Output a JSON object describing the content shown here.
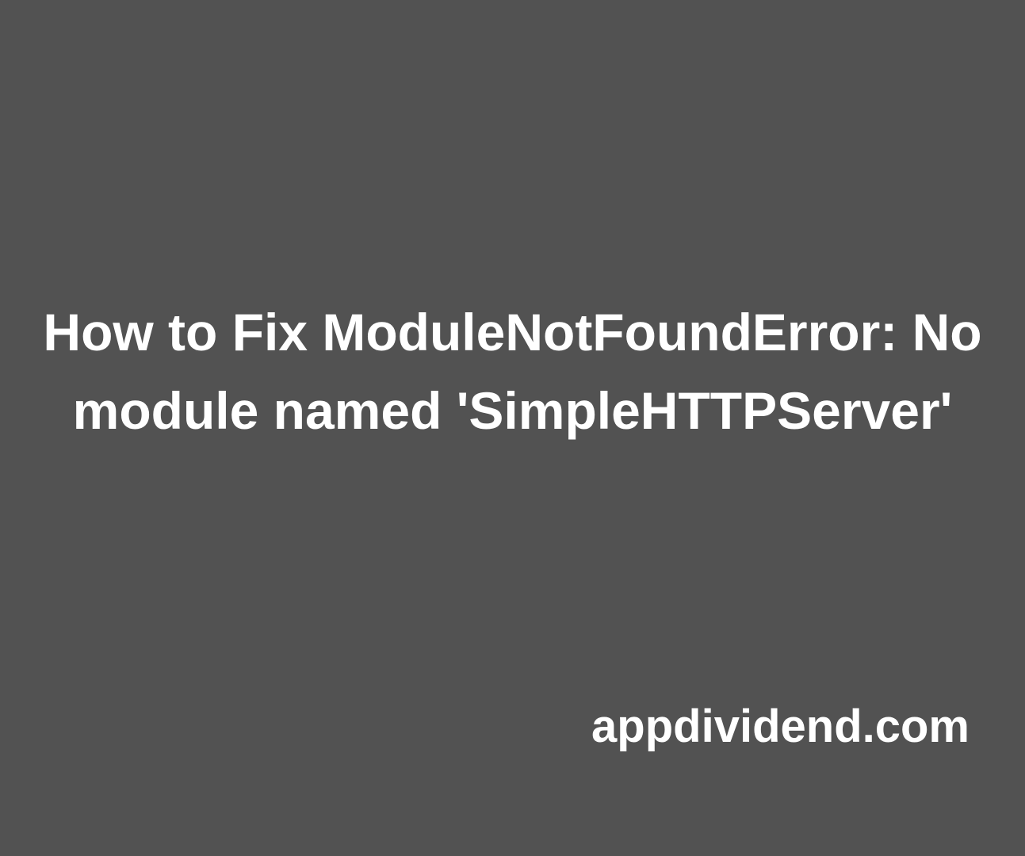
{
  "title": "How to Fix ModuleNotFoundError: No module named 'SimpleHTTPServer'",
  "site": "appdividend.com"
}
